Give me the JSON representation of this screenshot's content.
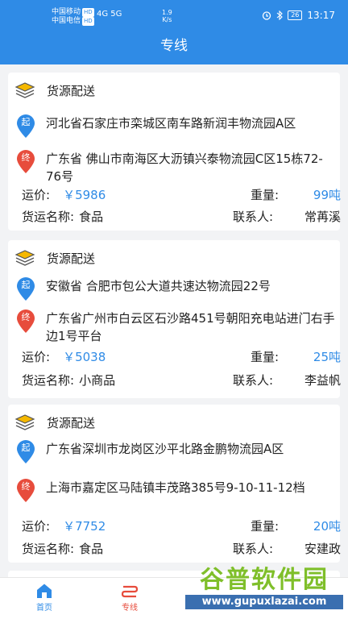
{
  "status_bar": {
    "carrier1": "中国移动",
    "carrier2": "中国电信",
    "hd": "HD",
    "signal": "4G 5G",
    "speed_value": "1.9",
    "speed_unit": "K/s",
    "battery": "26",
    "time": "13:17"
  },
  "header": {
    "title": "专线"
  },
  "cards": [
    {
      "title": "货源配送",
      "origin_badge": "起",
      "origin": "河北省石家庄市栾城区南车路新润丰物流园A区",
      "dest_badge": "终",
      "destination": "广东省 佛山市南海区大沥镇兴泰物流园C区15栋72-76号",
      "price_label": "运价:",
      "price": "￥5986",
      "weight_label": "重量:",
      "weight": "99吨",
      "goods_label": "货运名称:",
      "goods": "食品",
      "contact_label": "联系人:",
      "contact": "常苒溪"
    },
    {
      "title": "货源配送",
      "origin_badge": "起",
      "origin": "安徽省 合肥市包公大道共速达物流园22号",
      "dest_badge": "终",
      "destination": "广东省广州市白云区石沙路451号朝阳充电站进门右手边1号平台",
      "price_label": "运价:",
      "price": "￥5038",
      "weight_label": "重量:",
      "weight": "25吨",
      "goods_label": "货运名称:",
      "goods": "小商品",
      "contact_label": "联系人:",
      "contact": "李益帆"
    },
    {
      "title": "货源配送",
      "origin_badge": "起",
      "origin": "广东省深圳市龙岗区沙平北路金鹏物流园A区",
      "dest_badge": "终",
      "destination": "上海市嘉定区马陆镇丰茂路385号9-10-11-12档",
      "price_label": "运价:",
      "price": "￥7752",
      "weight_label": "重量:",
      "weight": "20吨",
      "goods_label": "货运名称:",
      "goods": "食品",
      "contact_label": "联系人:",
      "contact": "安建政"
    }
  ],
  "tabs": [
    {
      "label": "首页",
      "icon": "home-icon"
    },
    {
      "label": "专线",
      "icon": "route-icon"
    }
  ],
  "watermark": {
    "text": "谷普软件园",
    "url": "www.gupuxlazai.com"
  },
  "colors": {
    "primary": "#2f8be6",
    "origin_pin": "#2f8be6",
    "dest_pin": "#e74c3c",
    "active_tab": "#e74c3c"
  }
}
